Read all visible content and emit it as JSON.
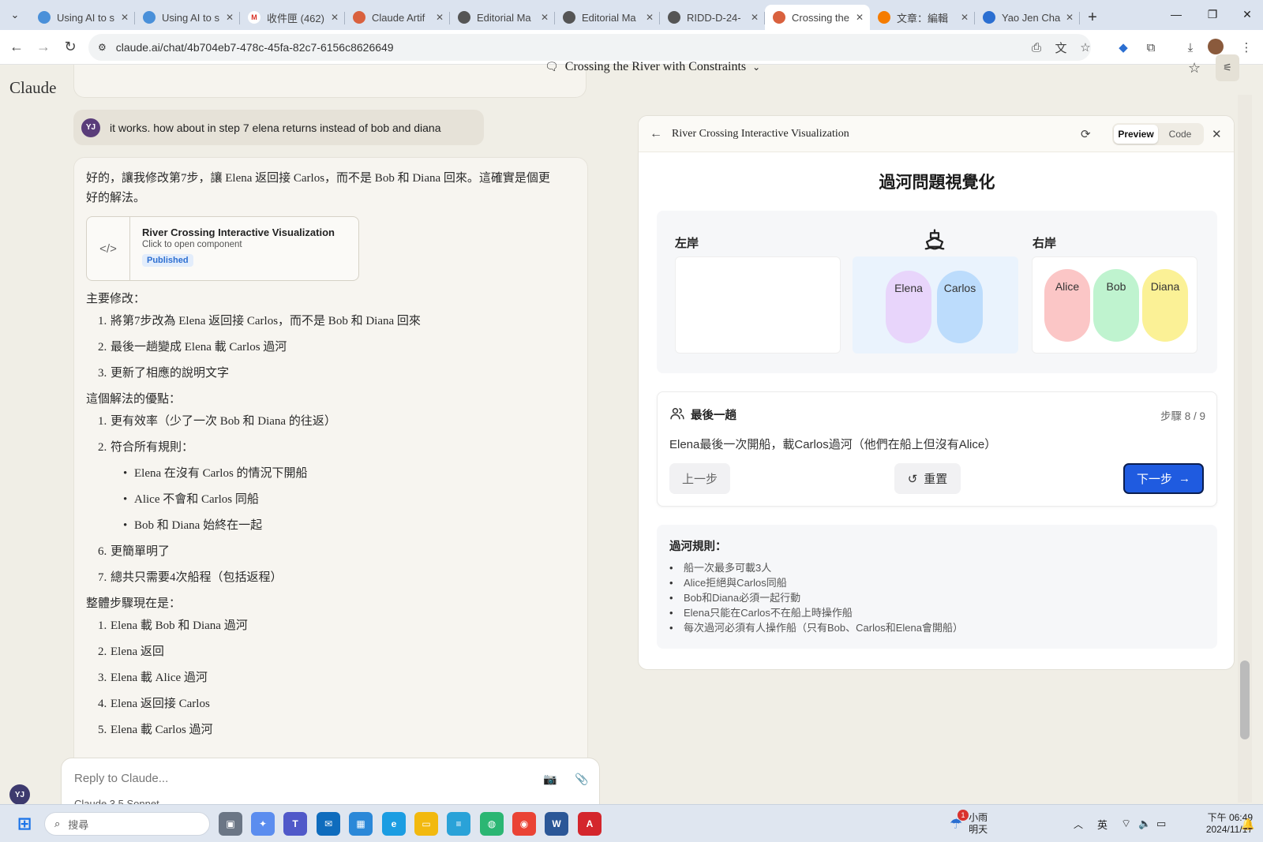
{
  "browser": {
    "tabs": [
      {
        "title": "Using AI to s",
        "fav_color": "#4a90d9",
        "icon": "globe-ai-icon"
      },
      {
        "title": "Using AI to s",
        "fav_color": "#4a90d9",
        "icon": "globe-ai-icon"
      },
      {
        "title": "收件匣 (462)",
        "fav_color": "#ffffff",
        "icon": "gmail-icon"
      },
      {
        "title": "Claude Artif",
        "fav_color": "#d9613e",
        "icon": "claude-icon"
      },
      {
        "title": "Editorial Ma",
        "fav_color": "#555555",
        "icon": "globe-icon"
      },
      {
        "title": "Editorial Ma",
        "fav_color": "#555555",
        "icon": "globe-icon"
      },
      {
        "title": "RIDD-D-24-",
        "fav_color": "#555555",
        "icon": "globe-icon"
      },
      {
        "title": "Crossing the",
        "fav_color": "#d9613e",
        "icon": "claude-icon",
        "active": true
      },
      {
        "title": "文章：編輯",
        "fav_color": "#f57c00",
        "icon": "blogger-icon"
      },
      {
        "title": "Yao Jen Cha",
        "fav_color": "#2b6fd1",
        "icon": "diamond-icon"
      }
    ],
    "url": "claude.ai/chat/4b704eb7-478c-45fa-82c7-6156c8626649"
  },
  "app": {
    "logo": "Claude",
    "chat_title": "Crossing the River with Constraints",
    "user_initials": "YJ",
    "user_message": "it works. how about in step 7 elena returns instead of bob and diana",
    "assistant": {
      "intro": "好的，讓我修改第7步，讓 Elena 返回接 Carlos，而不是 Bob 和 Diana 回來。這確實是個更好的解法。",
      "artifact_card": {
        "title": "River Crossing Interactive Visualization",
        "subtitle": "Click to open component",
        "badge": "Published"
      },
      "changes_heading": "主要修改：",
      "changes": [
        "將第7步改為 Elena 返回接 Carlos，而不是 Bob 和 Diana 回來",
        "最後一趟變成 Elena 載 Carlos 過河",
        "更新了相應的說明文字"
      ],
      "advantages_heading": "這個解法的優點：",
      "advantage_1": "更有效率（少了一次 Bob 和 Diana 的往返）",
      "advantage_2": "符合所有規則：",
      "advantage_2_sub": [
        "Elena 在沒有 Carlos 的情況下開船",
        "Alice 不會和 Carlos 同船",
        "Bob 和 Diana 始終在一起"
      ],
      "advantage_3": "更簡單明了",
      "advantage_4": "總共只需要4次船程（包括返程）",
      "steps_heading": "整體步驟現在是：",
      "steps": [
        "Elena 載 Bob 和 Diana 過河",
        "Elena 返回",
        "Elena 載 Alice 過河",
        "Elena 返回接 Carlos",
        "Elena 載 Carlos 過河"
      ]
    },
    "composer": {
      "placeholder": "Reply to Claude...",
      "model": "Claude 3.5 Sonnet"
    }
  },
  "artifact_panel": {
    "title": "River Crossing Interactive Visualization",
    "preview_label": "Preview",
    "code_label": "Code",
    "viz_title": "過河問題視覺化",
    "left_bank_label": "左岸",
    "right_bank_label": "右岸",
    "boat_people": [
      {
        "name": "Elena",
        "color": "#e8d5fb"
      },
      {
        "name": "Carlos",
        "color": "#bcdcfc"
      }
    ],
    "right_people": [
      {
        "name": "Alice",
        "color": "#fbc6c6"
      },
      {
        "name": "Bob",
        "color": "#bff3cf"
      },
      {
        "name": "Diana",
        "color": "#fbf196"
      }
    ],
    "step_title": "最後一趟",
    "step_counter": "步驟 8 / 9",
    "step_description": "Elena最後一次開船，載Carlos過河（他們在船上但沒有Alice）",
    "prev_label": "上一步",
    "reset_label": "重置",
    "next_label": "下一步",
    "rules_title": "過河規則：",
    "rules": [
      "船一次最多可載3人",
      "Alice拒絕與Carlos同船",
      "Bob和Diana必須一起行動",
      "Elena只能在Carlos不在船上時操作船",
      "每次過河必須有人操作船（只有Bob、Carlos和Elena會開船）"
    ]
  },
  "taskbar": {
    "search_placeholder": "搜尋",
    "weather_temp": "小雨",
    "weather_day": "明天",
    "notification_count": "1",
    "ime": "英",
    "time": "下午 06:49",
    "date": "2024/11/17"
  }
}
